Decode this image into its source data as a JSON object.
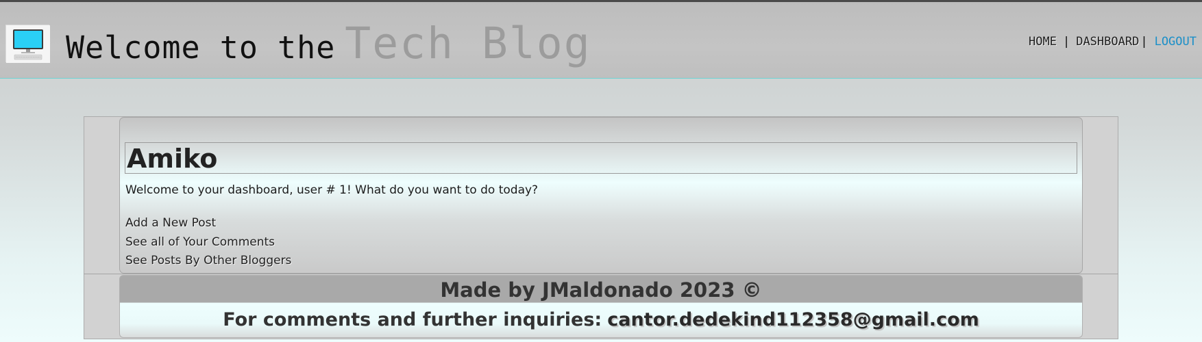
{
  "header": {
    "title_prefix": "Welcome to the",
    "title_accent": "Tech Blog",
    "logo_icon": "computer-monitor-icon",
    "nav": {
      "home": "HOME",
      "separator": "|",
      "dashboard": "DASHBOARD",
      "separator2": "|",
      "logout": "LOGOUT"
    }
  },
  "dashboard": {
    "username": "Amiko",
    "welcome": "Welcome to your dashboard, user # 1! What do you want to do today?",
    "actions": [
      {
        "label": "Add a New Post"
      },
      {
        "label": "See all of Your Comments"
      },
      {
        "label": "See Posts By Other Bloggers"
      }
    ]
  },
  "footer": {
    "made_by": "Made by JMaldonado 2023 ©",
    "inquiries_label": "For comments and further inquiries:",
    "email": "cantor.dedekind112358@gmail.com"
  },
  "colors": {
    "logout_link": "#1a8fc8",
    "title_accent": "#9c9c9c",
    "header_border": "#6fd3d3"
  }
}
